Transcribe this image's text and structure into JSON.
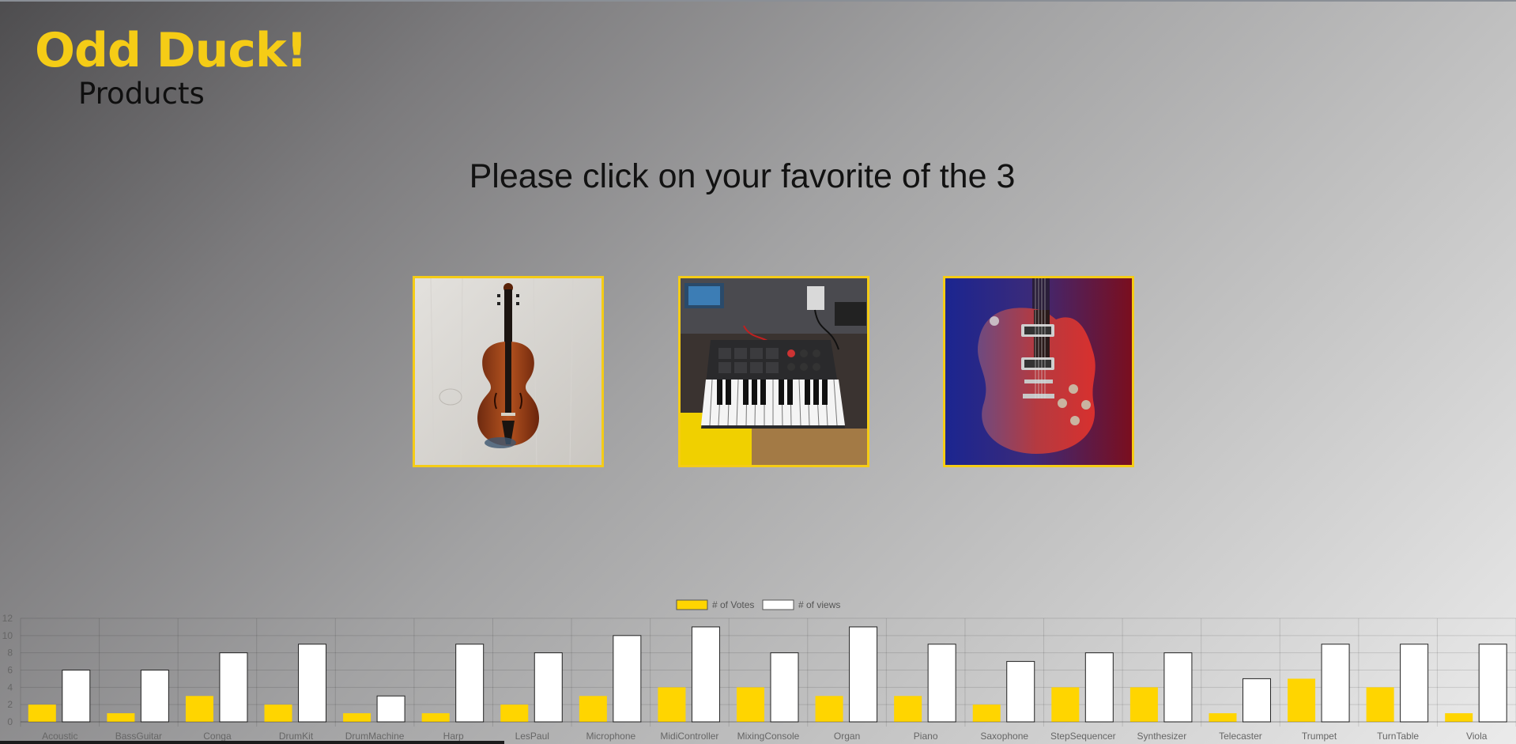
{
  "header": {
    "title": "Odd Duck!",
    "subtitle": "Products"
  },
  "instructions": "Please click on your favorite of the 3",
  "products": [
    {
      "name": "violin-image"
    },
    {
      "name": "midi-controller-image"
    },
    {
      "name": "les-paul-guitar-image"
    }
  ],
  "colors": {
    "accent": "#f5cc16",
    "votes_bar": "#ffd500",
    "views_bar": "#ffffff"
  },
  "chart_data": {
    "type": "bar",
    "categories": [
      "Acoustic",
      "BassGuitar",
      "Conga",
      "DrumKit",
      "DrumMachine",
      "Harp",
      "LesPaul",
      "Microphone",
      "MidiController",
      "MixingConsole",
      "Organ",
      "Piano",
      "Saxophone",
      "StepSequencer",
      "Synthesizer",
      "Telecaster",
      "Trumpet",
      "TurnTable",
      "Viola"
    ],
    "series": [
      {
        "name": "# of Votes",
        "values": [
          2,
          1,
          3,
          2,
          1,
          1,
          2,
          3,
          4,
          4,
          3,
          3,
          2,
          4,
          4,
          1,
          5,
          4,
          1
        ]
      },
      {
        "name": "# of views",
        "values": [
          6,
          6,
          8,
          9,
          3,
          9,
          8,
          10,
          11,
          8,
          11,
          9,
          7,
          8,
          8,
          5,
          9,
          9,
          9
        ]
      }
    ],
    "ylim": [
      0,
      12
    ],
    "yticks": [
      0,
      2,
      4,
      6,
      8,
      10,
      12
    ],
    "grid": true,
    "legend": "top-center"
  }
}
